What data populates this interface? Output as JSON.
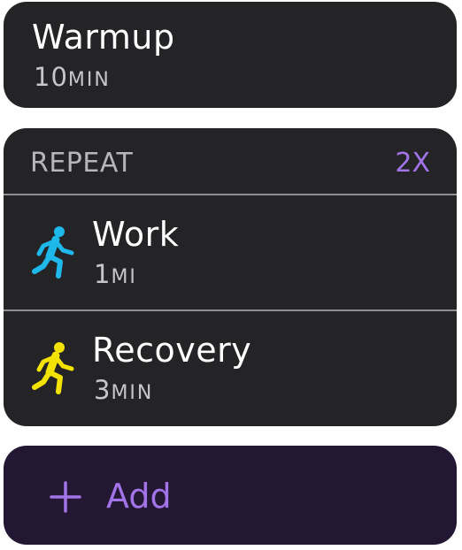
{
  "colors": {
    "card_bg": "#242426",
    "add_bg": "#231734",
    "accent": "#a373e8",
    "work_icon": "#1fb8ea",
    "recovery_icon": "#f2e205",
    "secondary_text": "#c6c6cc"
  },
  "warmup": {
    "title": "Warmup",
    "value": "10",
    "unit": "MIN"
  },
  "repeat": {
    "label": "REPEAT",
    "count": "2X",
    "items": [
      {
        "title": "Work",
        "value": "1",
        "unit": "MI",
        "icon": "running-figure-icon"
      },
      {
        "title": "Recovery",
        "value": "3",
        "unit": "MIN",
        "icon": "running-figure-icon"
      }
    ]
  },
  "add": {
    "label": "Add",
    "icon": "plus-icon"
  }
}
